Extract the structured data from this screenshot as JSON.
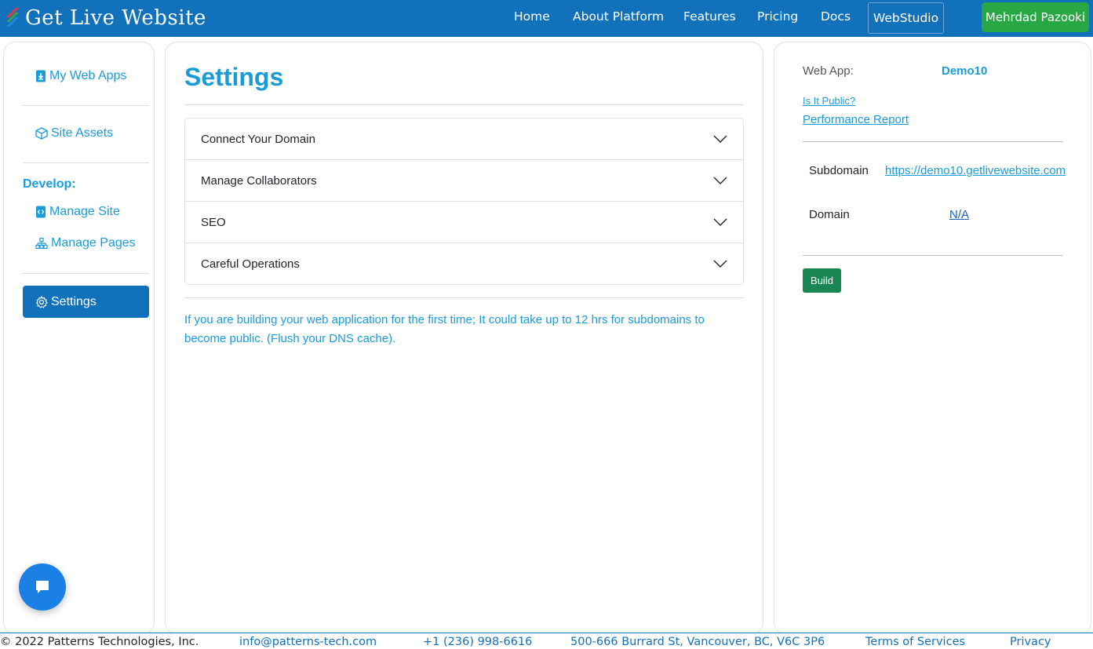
{
  "navbar": {
    "brand": "Get Live Website",
    "links": [
      "Home",
      "About Platform",
      "Features",
      "Pricing",
      "Docs"
    ],
    "webstudio": "WebStudio",
    "user": "Mehrdad Pazooki"
  },
  "sidebar": {
    "my_web_apps": "My Web Apps",
    "site_assets": "Site Assets",
    "develop_heading": "Develop:",
    "manage_site": "Manage Site",
    "manage_pages": "Manage Pages",
    "settings": "Settings"
  },
  "main": {
    "title": "Settings",
    "accordion": [
      "Connect Your Domain",
      "Manage Collaborators",
      "SEO",
      "Careful Operations"
    ],
    "note": "If you are building your web application for the first time; It could take up to 12 hrs for subdomains to become public. (Flush your DNS cache)."
  },
  "webapp": {
    "label": "Web App:",
    "name": "Demo10",
    "is_public": "Is It Public?",
    "performance_report": "Performance Report",
    "subdomain_label": "Subdomain",
    "subdomain_value": "https://demo10.getlivewebsite.com",
    "domain_label": "Domain",
    "domain_value": "N/A",
    "build": "Build"
  },
  "footer": {
    "copyright": "© 2022 Patterns Technologies, Inc.",
    "email": "info@patterns-tech.com",
    "phone": "+1 (236) 998-6616",
    "address": "500-666 Burrard St, Vancouver, BC, V6C 3P6",
    "terms": "Terms of Services",
    "privacy": "Privacy"
  },
  "colors": {
    "navbar": "#1171ba",
    "accent": "#1a9cd8",
    "user_button": "#28a745",
    "build_button": "#198754",
    "chat_button": "#1a80e6"
  },
  "icons": {
    "brand": "brand-logo-icon",
    "my_web_apps": "file-download-icon",
    "site_assets": "box-icon",
    "manage_site": "code-file-icon",
    "manage_pages": "sitemap-icon",
    "settings": "gear-icon",
    "accordion": "chevron-down-icon",
    "chat": "chat-icon"
  }
}
